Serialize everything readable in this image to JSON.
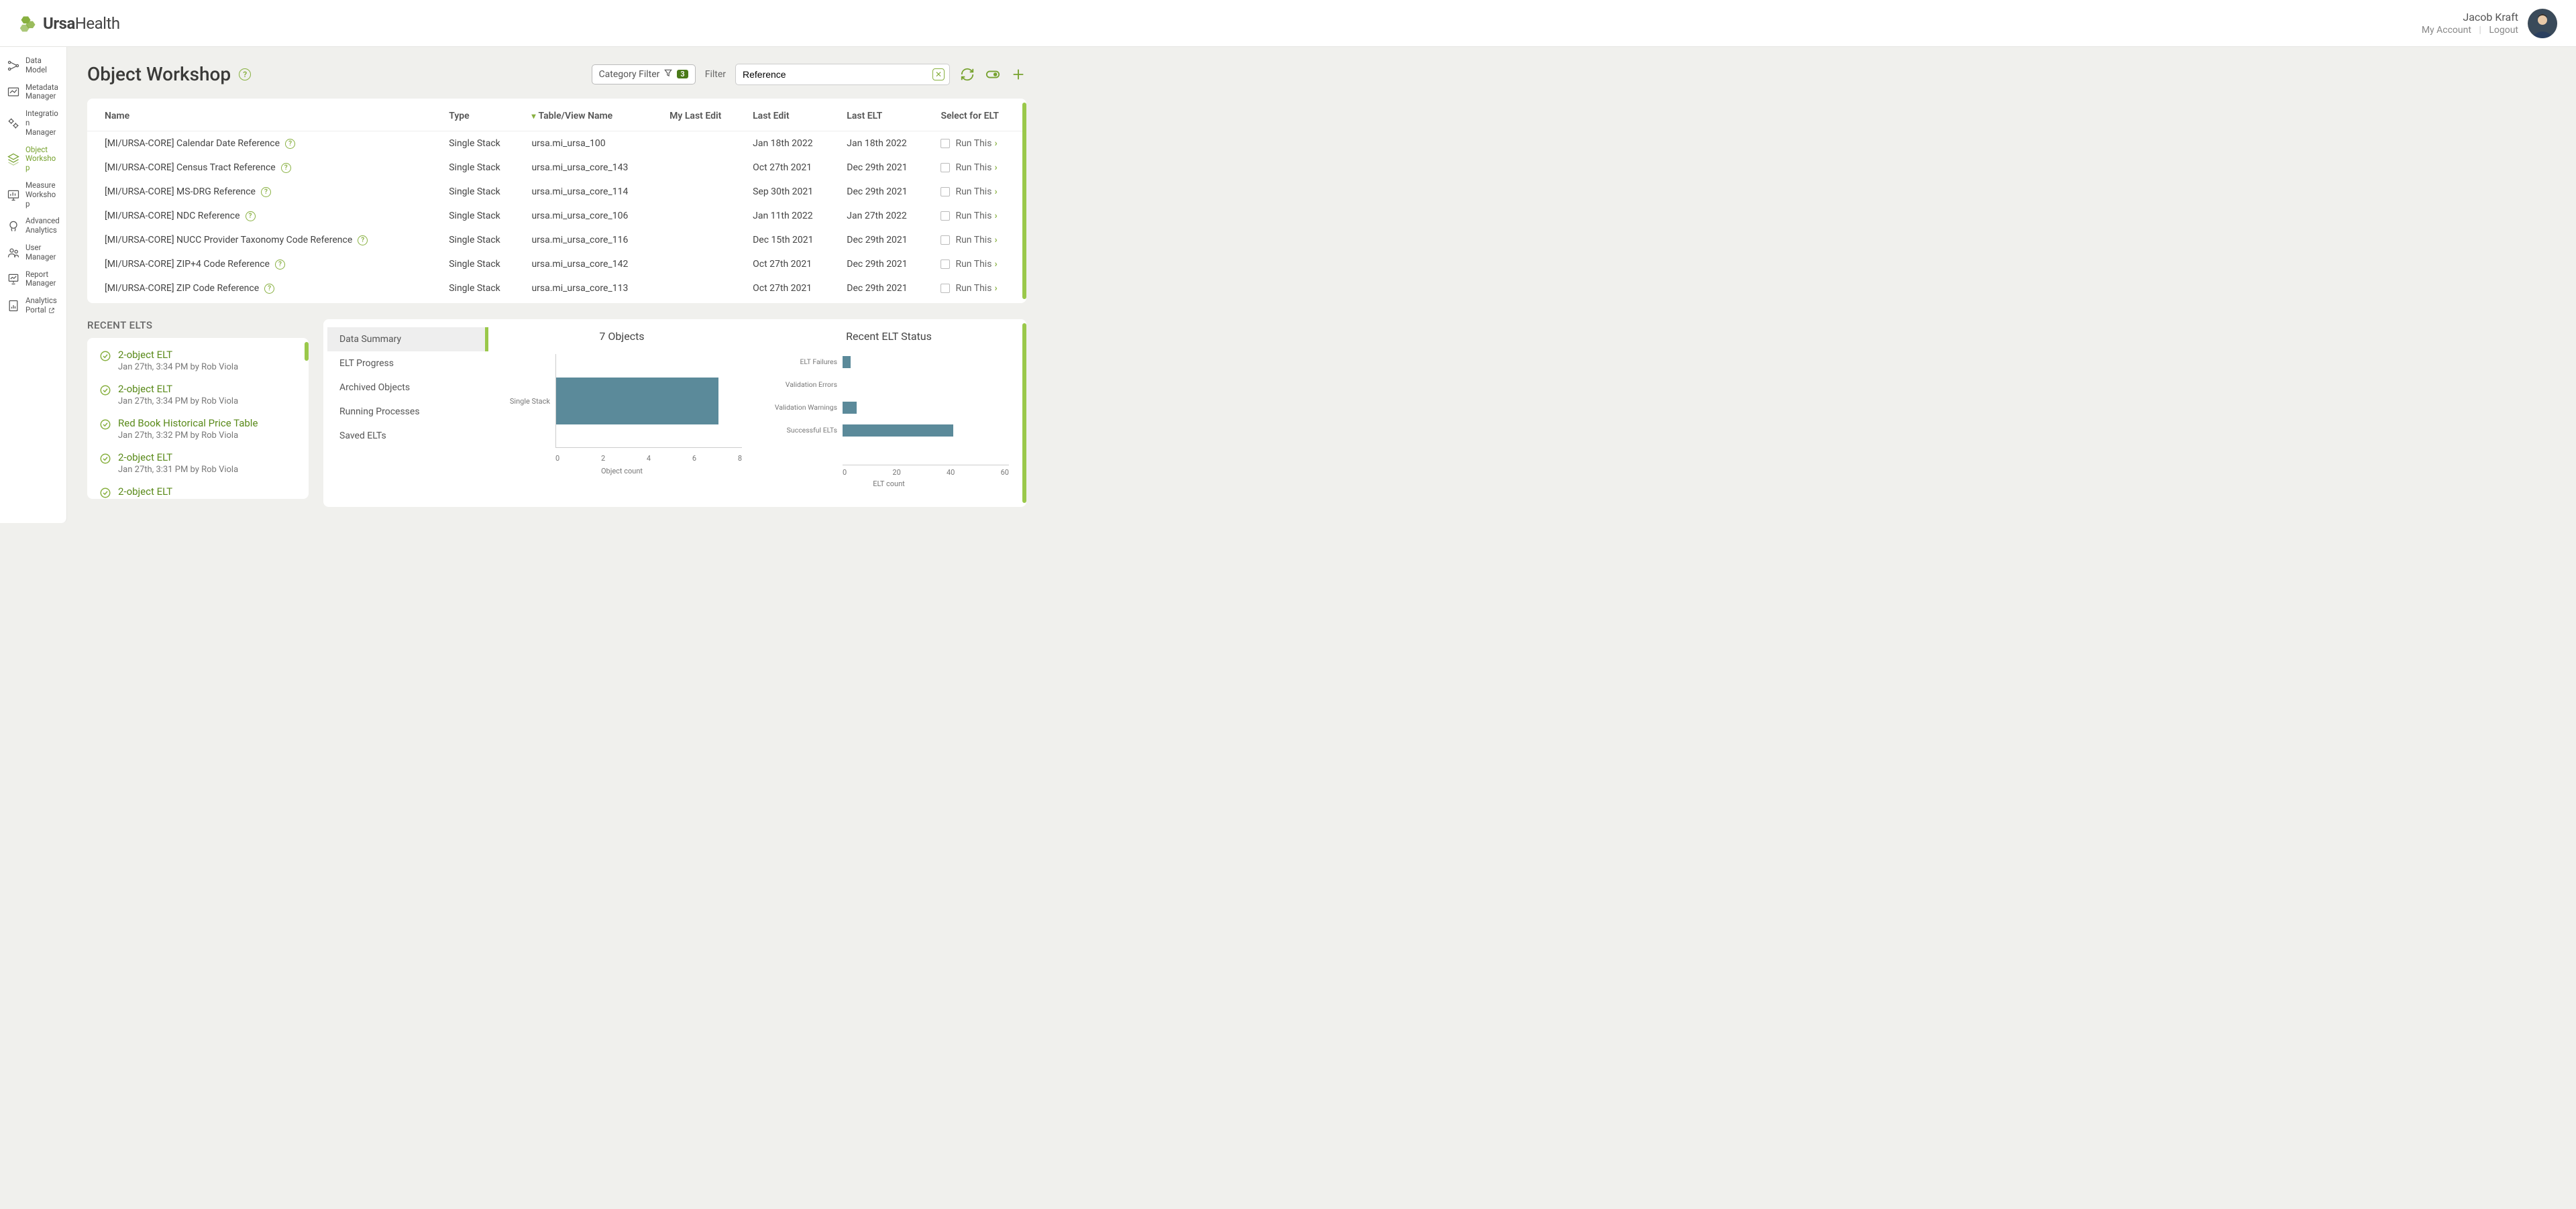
{
  "header": {
    "brand_bold": "Ursa",
    "brand_light": "Health",
    "user_name": "Jacob Kraft",
    "my_account_label": "My Account",
    "logout_label": "Logout"
  },
  "sidebar": {
    "items": [
      {
        "label": "Data Model"
      },
      {
        "label": "Metadata Manager"
      },
      {
        "label": "Integration Manager"
      },
      {
        "label": "Object Workshop"
      },
      {
        "label": "Measure Workshop"
      },
      {
        "label": "Advanced Analytics"
      },
      {
        "label": "User Manager"
      },
      {
        "label": "Report Manager"
      },
      {
        "label": "Analytics Portal"
      }
    ]
  },
  "page": {
    "title": "Object Workshop",
    "category_filter_label": "Category Filter",
    "category_filter_count": "3",
    "filter_label": "Filter",
    "filter_value": "Reference"
  },
  "table": {
    "columns": {
      "name": "Name",
      "type": "Type",
      "table_view": "Table/View Name",
      "my_last_edit": "My Last Edit",
      "last_edit": "Last Edit",
      "last_elt": "Last ELT",
      "select": "Select for ELT"
    },
    "run_label": "Run This",
    "rows": [
      {
        "name": "[MI/URSA-CORE] Calendar Date Reference",
        "type": "Single Stack",
        "tv": "ursa.mi_ursa_100",
        "my_last_edit": "",
        "last_edit": "Jan 18th 2022",
        "last_elt": "Jan 18th 2022"
      },
      {
        "name": "[MI/URSA-CORE] Census Tract Reference",
        "type": "Single Stack",
        "tv": "ursa.mi_ursa_core_143",
        "my_last_edit": "",
        "last_edit": "Oct 27th 2021",
        "last_elt": "Dec 29th 2021"
      },
      {
        "name": "[MI/URSA-CORE] MS-DRG Reference",
        "type": "Single Stack",
        "tv": "ursa.mi_ursa_core_114",
        "my_last_edit": "",
        "last_edit": "Sep 30th 2021",
        "last_elt": "Dec 29th 2021"
      },
      {
        "name": "[MI/URSA-CORE] NDC Reference",
        "type": "Single Stack",
        "tv": "ursa.mi_ursa_core_106",
        "my_last_edit": "",
        "last_edit": "Jan 11th 2022",
        "last_elt": "Jan 27th 2022"
      },
      {
        "name": "[MI/URSA-CORE] NUCC Provider Taxonomy Code Reference",
        "type": "Single Stack",
        "tv": "ursa.mi_ursa_core_116",
        "my_last_edit": "",
        "last_edit": "Dec 15th 2021",
        "last_elt": "Dec 29th 2021"
      },
      {
        "name": "[MI/URSA-CORE] ZIP+4 Code Reference",
        "type": "Single Stack",
        "tv": "ursa.mi_ursa_core_142",
        "my_last_edit": "",
        "last_edit": "Oct 27th 2021",
        "last_elt": "Dec 29th 2021"
      },
      {
        "name": "[MI/URSA-CORE] ZIP Code Reference",
        "type": "Single Stack",
        "tv": "ursa.mi_ursa_core_113",
        "my_last_edit": "",
        "last_edit": "Oct 27th 2021",
        "last_elt": "Dec 29th 2021"
      }
    ]
  },
  "recent": {
    "title": "RECENT ELTS",
    "items": [
      {
        "name": "2-object ELT",
        "meta": "Jan 27th, 3:34 PM by Rob Viola"
      },
      {
        "name": "2-object ELT",
        "meta": "Jan 27th, 3:34 PM by Rob Viola"
      },
      {
        "name": "Red Book Historical Price Table",
        "meta": "Jan 27th, 3:32 PM by Rob Viola"
      },
      {
        "name": "2-object ELT",
        "meta": "Jan 27th, 3:31 PM by Rob Viola"
      },
      {
        "name": "2-object ELT",
        "meta": ""
      }
    ]
  },
  "summary": {
    "tabs": [
      {
        "label": "Data Summary"
      },
      {
        "label": "ELT Progress"
      },
      {
        "label": "Archived Objects"
      },
      {
        "label": "Running Processes"
      },
      {
        "label": "Saved ELTs"
      }
    ],
    "objects_chart_title": "7 Objects",
    "elt_chart_title": "Recent ELT Status"
  },
  "chart_data": [
    {
      "type": "bar",
      "orientation": "horizontal",
      "title": "7 Objects",
      "categories": [
        "Single Stack"
      ],
      "values": [
        7
      ],
      "xlabel": "Object count",
      "ylabel": "",
      "xlim": [
        0,
        8
      ],
      "xticks": [
        0,
        2,
        4,
        6,
        8
      ]
    },
    {
      "type": "bar",
      "orientation": "horizontal",
      "title": "Recent ELT Status",
      "categories": [
        "ELT Failures",
        "Validation Errors",
        "Validation Warnings",
        "Successful ELTs"
      ],
      "values": [
        3,
        0,
        5,
        40
      ],
      "xlabel": "ELT count",
      "ylabel": "",
      "xlim": [
        0,
        60
      ],
      "xticks": [
        0,
        20,
        40,
        60
      ]
    }
  ],
  "colors": {
    "accent_green": "#88b040",
    "bar_teal": "#5b8a9a"
  }
}
